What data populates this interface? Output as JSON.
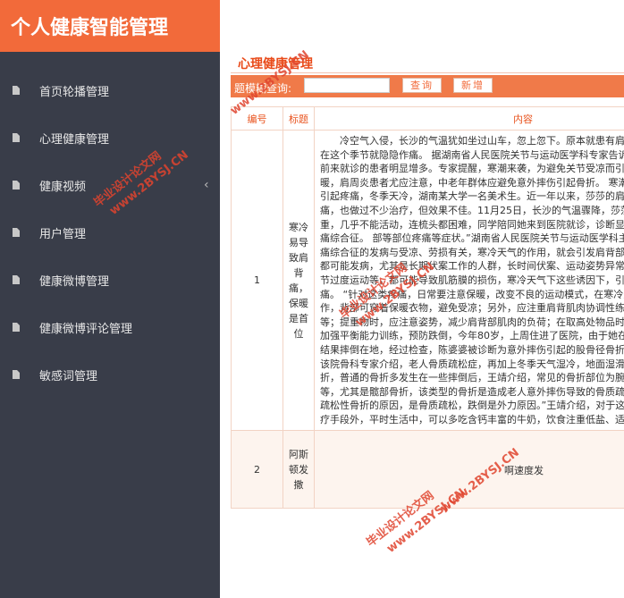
{
  "app": {
    "title": "个人健康智能管理"
  },
  "sidebar": {
    "items": [
      {
        "label": "首页轮播管理",
        "icon": "document-icon"
      },
      {
        "label": "心理健康管理",
        "icon": "document-icon"
      },
      {
        "label": "健康视频",
        "icon": "document-icon",
        "chevron": "‹"
      },
      {
        "label": "用户管理",
        "icon": "document-icon"
      },
      {
        "label": "健康微博管理",
        "icon": "document-icon"
      },
      {
        "label": "健康微博评论管理",
        "icon": "document-icon"
      },
      {
        "label": "敏感词管理",
        "icon": "document-icon"
      }
    ]
  },
  "main": {
    "section_title": "心理健康管理",
    "toolbar": {
      "search_label": "题模糊查询:",
      "search_value": "",
      "search_button": "查询",
      "add_button": "新增"
    },
    "table": {
      "headers": [
        "编号",
        "标题",
        "内容"
      ],
      "rows": [
        {
          "id": "1",
          "title": "寒冷易导致肩背痛，保暖是首位",
          "content": "冷空气入侵，长沙的气温犹如坐过山车，忽上忽下。原本就患有肩周炎、腰背痛等的人，在这个季节就隐隐作痛。 据湖南省人民医院关节与运动医学科专家告诉记者，近期因肩背疼痛前来就诊的患者明显增多。专家提醒，寒潮来袭，为避免关节受凉而引起疼痛，老人应注意保暖，肩周炎患者尤应注意，中老年群体应避免意外摔伤引起骨折。 寒潮来临前别让肩背受凉而引起疼痛，冬季天冷，湖南某大学一名美术生。近一年以来，莎莎的肩背部总是反反复复的疼痛，也做过不少治疗，但效果不佳。11月25日，长沙的气温骤降，莎莎的整个肩背部疼痛加重，几乎不能活动，连梳头都困难，同学陪同她来到医院就诊，诊断显示莎莎患上了肌筋膜疼痛综合征。 部等部位疼痛等症状。”湖南省人民医院关节与运动医学科主任医师介绍，肌筋膜疼痛综合征的发病与受凉、劳损有关，寒冷天气的作用，就会引发肩背部明显疼痛，任何年龄段都可能发病，尤其是长期伏案工作的人群，长时间伏案、运动姿势异常、肩关节负荷过重、关节过度运动等，都可能导致肌筋膜的损伤，寒冷天气下这些诱因下，引发严重的肩背及腰背疼痛。 “针对这类疼痛，日常要注意保暖，改变不良的运动模式，在寒冷天气下要做好保暖工作，背部可穿着保暖衣物，避免受凉；另外，应注重肩背肌肉协调性练习，肌肉放松、拉伸等；提重物时，应注意姿势，减少肩背部肌肉的负荷；在取高处物品时，可先动身，再动手。 加强平衡能力训练，预防跌倒，今年80岁，上周住进了医院，由于她在家中做运动时不小心，结果摔倒在地，经过检查，陈婆婆被诊断为意外摔伤引起的股骨径骨折，无法行走只能卧床。该院骨科专家介绍，老人骨质疏松症，再加上冬季天气湿冷，地面湿滑，很容易摔倒引起骨折，普通的骨折多发生在一些摔倒后，王靖介绍，常见的骨折部位为腕部、脊柱椎体、髋部等，尤其是髋部骨折，该类型的骨折是造成老人意外摔伤导致的骨质疏松性骨折。 “引起骨质疏松性骨折的原因，是骨质疏松，跌倒是外力原因。”王靖介绍，对于这类病疾，除了必要的治疗手段外，平时生活中，可以多吃含钙丰富的牛奶，饮食注重低盐、适量补充蛋白；生活习惯上，避免吸烟、酗酒，慎用影响骨代谢的药物，如抗癫痫剂、抗惊厥药等。同时，选择适当的运动方式，中老年群体可适当进行有氧运动，根据自己身体情况适当步行，每天5000步至10000步，也可骑自行车，或练太极拳等舒缓运动。对于有跌倒风险的人，可使用预防跌倒的髋保护垫，以防止在寒冷天气下意外摔倒引起骨折，还可以进行一些平衡能力的训练，以减少跌倒的相关性损伤。骨科专家介绍，健康的人可以尝试。最简单的训练方法，就是扶着桌子或椅子单腿站立，尽量保持平衡，然后换另一侧，每个动作10秒，重复10次至15次，换一侧再重复。另外，还可以进行肩膀、腰腹的锻炼，手臂自然下垂，小腿与地面垂直，膝盖"
        },
        {
          "id": "2",
          "title": "阿斯顿发撒",
          "content": "啊速度发"
        }
      ]
    }
  },
  "watermarks": [
    "毕业设计论文网",
    "www.2BYSJ.CN"
  ],
  "colors": {
    "accent": "#f26a3a",
    "sidebar_bg": "#393d49",
    "title_red": "#e94a19",
    "toolbar_bg": "#f07a49"
  }
}
